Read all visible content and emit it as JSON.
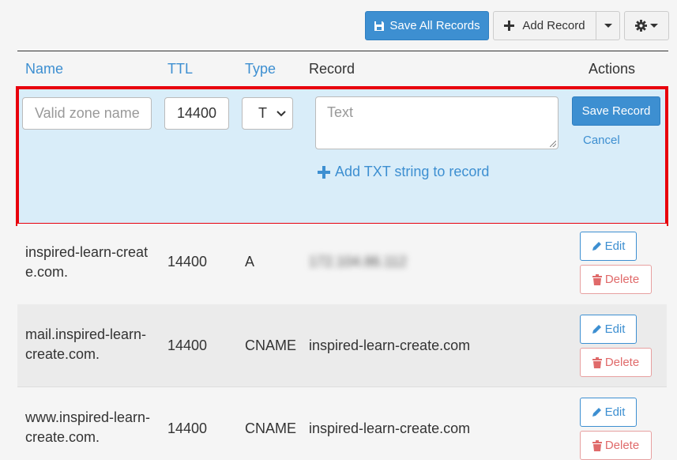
{
  "toolbar": {
    "save_all_label": "Save All Records",
    "add_record_label": "Add Record"
  },
  "table": {
    "headers": {
      "name": "Name",
      "ttl": "TTL",
      "type": "Type",
      "record": "Record",
      "actions": "Actions"
    }
  },
  "edit_form": {
    "name_placeholder": "Valid zone name",
    "ttl_value": "14400",
    "type_value": "T",
    "record_placeholder": "Text",
    "add_txt_label": "Add TXT string to record",
    "save_label": "Save Record",
    "cancel_label": "Cancel"
  },
  "rows": [
    {
      "name": "inspired-learn-create.com.",
      "ttl": "14400",
      "type": "A",
      "record": "172.104.86.112",
      "edit_label": "Edit",
      "delete_label": "Delete"
    },
    {
      "name": "mail.inspired-learn-create.com.",
      "ttl": "14400",
      "type": "CNAME",
      "record": "inspired-learn-create.com",
      "edit_label": "Edit",
      "delete_label": "Delete"
    },
    {
      "name": "www.inspired-learn-create.com.",
      "ttl": "14400",
      "type": "CNAME",
      "record": "inspired-learn-create.com",
      "edit_label": "Edit",
      "delete_label": "Delete"
    }
  ],
  "colors": {
    "primary": "#3d8fd1",
    "edit_row_bg": "#d9edf9",
    "highlight_border": "#e8000d",
    "delete": "#e06a6a"
  }
}
